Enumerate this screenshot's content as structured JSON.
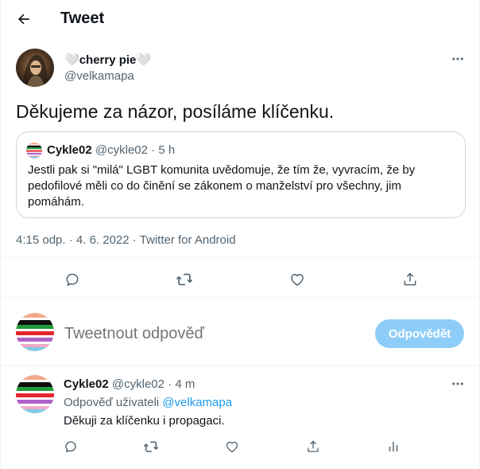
{
  "header": {
    "title": "Tweet",
    "back_icon": "arrow-left-icon"
  },
  "main_tweet": {
    "name_prefix": "🤍",
    "name": "cherry pie",
    "name_suffix": "🤍",
    "handle": "@velkamapa",
    "text": "Děkujeme za názor, posíláme klíčenku.",
    "timestamp": "4:15 odp. · 4. 6. 2022 · Twitter for Android",
    "quote": {
      "name": "Cykle02",
      "handle": "@cykle02",
      "sep": " · ",
      "age": "5 h",
      "text": "Jestli pak si \"milá\" LGBT komunita uvědomuje, že tím že, vyvracím, že by pedofilové měli co do činění se zákonem o manželství pro všechny, jim pomáhám."
    },
    "actions": [
      "reply-icon",
      "retweet-icon",
      "like-icon",
      "share-icon"
    ]
  },
  "reply_box": {
    "placeholder": "Tweetnout odpověď",
    "button_label": "Odpovědět",
    "button_color": "#8ecdf8"
  },
  "reply_tweet": {
    "name": "Cykle02",
    "handle": "@cykle02",
    "sep": " · ",
    "age": "4 m",
    "reply_to_label": "Odpověď uživateli ",
    "reply_to_handle": "@velkamapa",
    "text": "Děkuji za klíčenku i propagaci.",
    "actions": [
      "reply-icon",
      "retweet-icon",
      "like-icon",
      "share-icon",
      "analytics-icon"
    ]
  },
  "colors": {
    "text_primary": "#0f1419",
    "text_secondary": "#536471",
    "accent": "#1d9bf0",
    "border": "#cfd9de"
  }
}
